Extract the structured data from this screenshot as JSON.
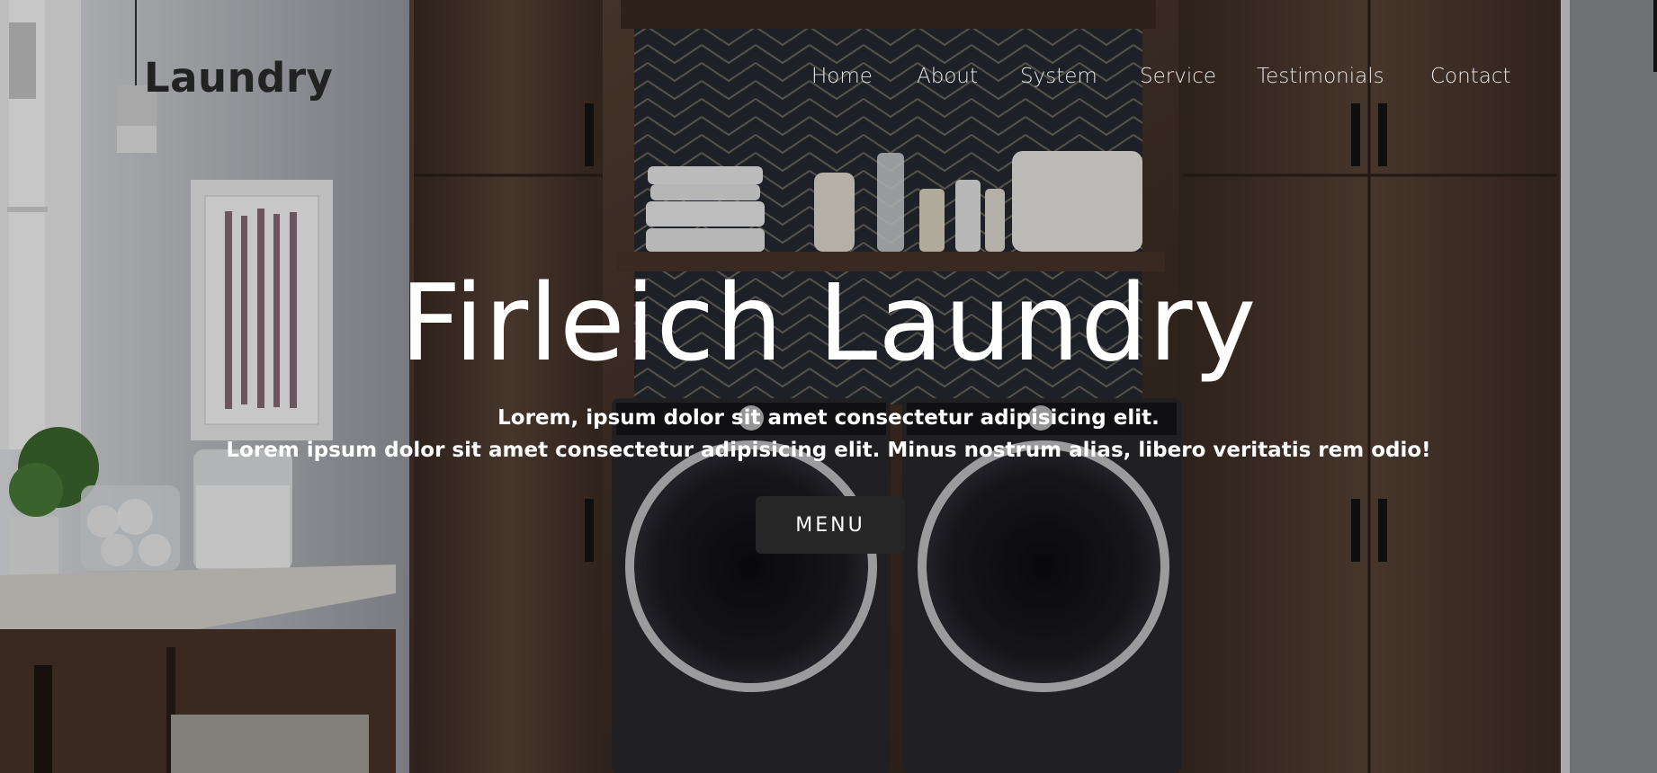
{
  "header": {
    "logo": "Laundry",
    "nav": [
      "Home",
      "About",
      "System",
      "Service",
      "Testimonials",
      "Contact"
    ]
  },
  "hero": {
    "title": "Firleich Laundry",
    "subtitle_line1": "Lorem, ipsum dolor sit amet consectetur adipisicing elit.",
    "subtitle_line2": "Lorem ipsum dolor sit amet consectetur adipisicing elit. Minus nostrum alias, libero veritatis rem odio!",
    "button_label": "MENU"
  },
  "colors": {
    "button_bg": "#262626",
    "text_light": "#ffffff",
    "logo": "#222222"
  }
}
